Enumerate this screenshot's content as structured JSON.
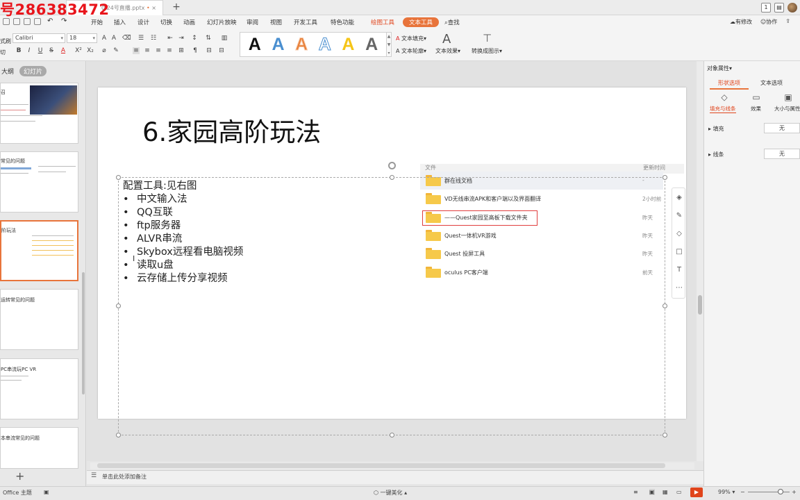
{
  "watermark": "号286383472",
  "titlebar": {
    "doc_tab": "0.24号直播.pptx",
    "new_tab": "+",
    "page_badge": "1"
  },
  "menu": {
    "items": [
      "开始",
      "插入",
      "设计",
      "切换",
      "动画",
      "幻灯片放映",
      "审阅",
      "视图",
      "开发工具",
      "特色功能"
    ],
    "draw_tool": "绘图工具",
    "text_tool": "文本工具",
    "search": "查找",
    "right": [
      "有修改",
      "协作"
    ]
  },
  "ribbon": {
    "font_name": "Calibri",
    "font_size": "18",
    "fmt_buttons": [
      "B",
      "I",
      "U",
      "S",
      "A",
      "X²",
      "X₂"
    ],
    "left_labels": [
      "式刷",
      "切"
    ],
    "wordart_colors": [
      "#111111",
      "#4a8fd0",
      "#e8803a",
      "#4a8fd0",
      "#f5c518",
      "#666666"
    ],
    "wordart_glyph": "A",
    "text_fill": "文本填充",
    "text_outline": "文本轮廓",
    "text_effect": "文本效果",
    "convert": "转换成图示"
  },
  "left_panel": {
    "outline_tab": "大纲",
    "slides_tab": "幻灯片",
    "thumbs": [
      "召",
      "常见的问题",
      "阶玩法",
      "运转常见的问题",
      "PC串流玩PC VR",
      "本串流常见的问题"
    ],
    "add": "+"
  },
  "slide": {
    "title": "6.家园高阶玩法",
    "lead": "配置工具:见右图",
    "bullets": [
      "中文输入法",
      "QQ互联",
      "ftp服务器",
      "ALVR串流",
      "Skybox远程看电脑视频",
      "读取u盘",
      "云存储上传分享视频"
    ]
  },
  "file_panel": {
    "col_name": "文件",
    "col_time": "更新时间",
    "rows": [
      {
        "name": "群在线文档",
        "time": "-"
      },
      {
        "name": "VD无线串流APK和客户端以及界面翻译",
        "time": "2小时前"
      },
      {
        "name": "——Quest家园至高板下载文件夹",
        "time": "昨天"
      },
      {
        "name": "Quest一体机VR游戏",
        "time": "昨天"
      },
      {
        "name": "Quest 投屏工具",
        "time": "昨天"
      },
      {
        "name": "oculus PC客户端",
        "time": "前天"
      }
    ]
  },
  "notes": "单击此处添加备注",
  "right_panel": {
    "title": "对象属性",
    "tab_shape": "形状选项",
    "tab_text": "文本选项",
    "sub_fill_line": "填充与线条",
    "sub_effect": "效果",
    "sub_size": "大小与属性",
    "fill_label": "填充",
    "fill_value": "无",
    "line_label": "线条",
    "line_value": "无"
  },
  "statusbar": {
    "theme": "Office 主题",
    "beautify": "一键美化",
    "zoom": "99%",
    "minus": "−",
    "plus": "+"
  }
}
